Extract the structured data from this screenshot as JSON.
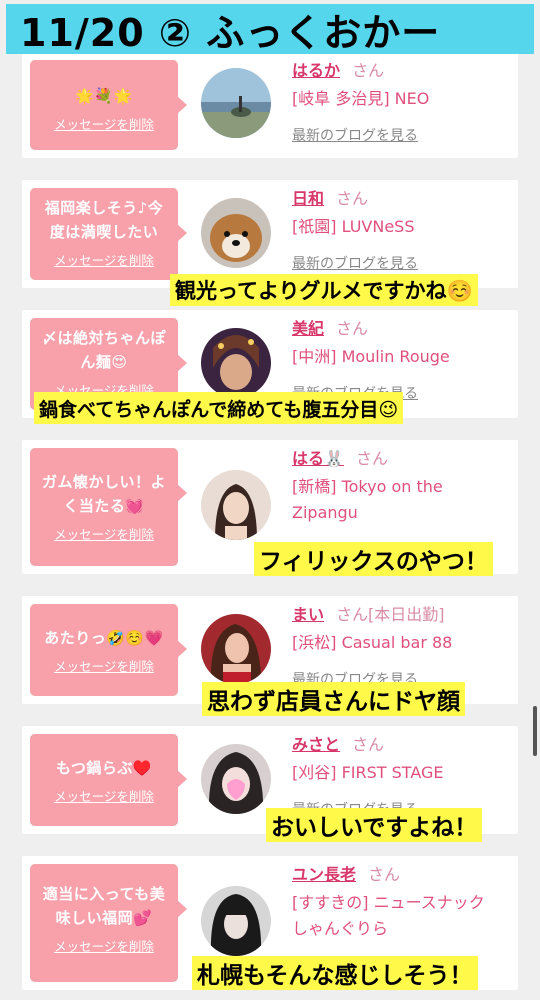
{
  "title": "11/20 ② ふっくおかー",
  "delete_label": "メッセージを削除",
  "blog_label": "最新のブログを見る",
  "san": "さん",
  "cards": [
    {
      "message": "🌟💐🌟",
      "name": "はるか",
      "extra": "",
      "shop": "[岐阜 多治見] NEO",
      "shop2": ""
    },
    {
      "message": "福岡楽しそう♪今度は満喫したい",
      "name": "日和",
      "extra": "",
      "shop": "[祇園] LUVNeSS",
      "shop2": ""
    },
    {
      "message": "〆は絶対ちゃんぽん麺😍",
      "name": "美紀",
      "extra": "",
      "shop": "[中洲] Moulin Rouge",
      "shop2": ""
    },
    {
      "message": "ガム懐かしい！よく当たる💓",
      "name": "はる🐰",
      "extra": "",
      "shop": "[新橋] Tokyo on the",
      "shop2": "Zipangu"
    },
    {
      "message": "あたりっ🤣☺️💗",
      "name": "まい",
      "extra": "[本日出勤]",
      "shop": "[浜松] Casual bar 88",
      "shop2": ""
    },
    {
      "message": "もつ鍋らぶ♥️",
      "name": "みさと",
      "extra": "",
      "shop": "[刈谷] FIRST STAGE",
      "shop2": ""
    },
    {
      "message": "適当に入っても美味しい福岡💕",
      "name": "ユン長老",
      "extra": "",
      "shop": "[すすきの] ニュースナック",
      "shop2": "しゃんぐりら"
    }
  ],
  "captions": [
    "観光ってよりグルメですかね☺️",
    "鍋食べてちゃんぽんで締めても腹五分目😉",
    "フィリックスのやつ！",
    "思わず店員さんにドヤ顔",
    "おいしいですよね！",
    "札幌もそんな感じしそう！"
  ]
}
